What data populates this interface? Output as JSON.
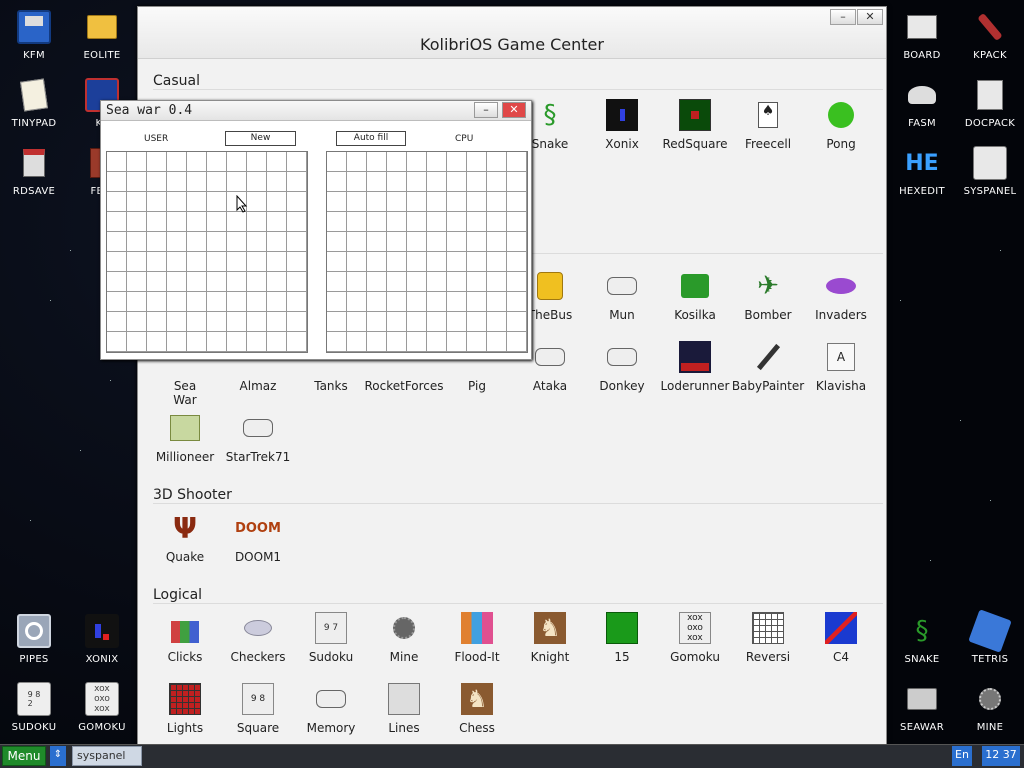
{
  "desktop": {
    "left_icons": [
      {
        "label": "KFM",
        "icon": "floppy-icon"
      },
      {
        "label": "EOLITE",
        "icon": "folder-icon"
      },
      {
        "label": "TINYPAD",
        "icon": "notepad-icon"
      },
      {
        "label": "KF",
        "icon": "app-icon"
      },
      {
        "label": "RDSAVE",
        "icon": "disk-save-icon"
      },
      {
        "label": "FB2I",
        "icon": "book-icon"
      },
      {
        "label": "PIPES",
        "icon": "pipes-icon"
      },
      {
        "label": "XONIX",
        "icon": "xonix-icon"
      },
      {
        "label": "SUDOKU",
        "icon": "sudoku-icon"
      },
      {
        "label": "GOMOKU",
        "icon": "gomoku-icon"
      }
    ],
    "right_icons": [
      {
        "label": "BOARD",
        "icon": "board-icon"
      },
      {
        "label": "KPACK",
        "icon": "wrench-icon"
      },
      {
        "label": "FASM",
        "icon": "fasm-icon"
      },
      {
        "label": "DOCPACK",
        "icon": "cabinet-icon"
      },
      {
        "label": "HEXEDIT",
        "icon": "hexedit-icon"
      },
      {
        "label": "SYSPANEL",
        "icon": "sliders-icon"
      },
      {
        "label": "SNAKE",
        "icon": "snake-icon"
      },
      {
        "label": "TETRIS",
        "icon": "tetris-icon"
      },
      {
        "label": "SEAWAR",
        "icon": "seawar-icon"
      },
      {
        "label": "MINE",
        "icon": "mine-icon"
      }
    ]
  },
  "game_center": {
    "title": "KolibriOS Game Center",
    "sections": {
      "casual": "Casual",
      "shooter": "3D Shooter",
      "logical": "Logical"
    },
    "casual_row1": [
      "Snake",
      "Xonix",
      "RedSquare",
      "Freecell",
      "Pong"
    ],
    "casual_row2": [
      "TheBus",
      "Mun",
      "Kosilka",
      "Bomber",
      "Invaders"
    ],
    "casual_row3": [
      "Sea\nWar",
      "Almaz",
      "Tanks",
      "RocketForces",
      "Pig",
      "Ataka",
      "Donkey",
      "Loderunner",
      "BabyPainter",
      "Klavisha"
    ],
    "casual_row4": [
      "Millioneer",
      "StarTrek71"
    ],
    "shooter_row": [
      "Quake",
      "DOOM1"
    ],
    "logical_row1": [
      "Clicks",
      "Checkers",
      "Sudoku",
      "Mine",
      "Flood-It",
      "Knight",
      "15",
      "Gomoku",
      "Reversi",
      "C4"
    ],
    "logical_row2": [
      "Lights",
      "Square",
      "Memory",
      "Lines",
      "Chess"
    ]
  },
  "seawar": {
    "title": "Sea war 0.4",
    "user_label": "USER",
    "cpu_label": "CPU",
    "new_button": "New",
    "autofill_button": "Auto fill"
  },
  "taskbar": {
    "menu": "Menu",
    "task": "syspanel",
    "lang": "En",
    "clock": "12 37"
  },
  "colors": {
    "menu_green": "#1f8a2a",
    "taskbar_blue": "#2a6fcf",
    "close_red": "#e04848"
  }
}
